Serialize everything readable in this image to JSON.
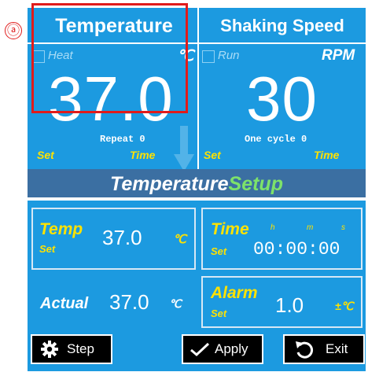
{
  "annotation": {
    "marker": "ⓐ"
  },
  "temperature": {
    "title": "Temperature",
    "heat_label": "Heat",
    "unit": "℃",
    "value": "37.0",
    "repeat": "Repeat 0",
    "set_label": "Set",
    "time_label": "Time"
  },
  "shaking": {
    "title": "Shaking Speed",
    "run_label": "Run",
    "unit": "RPM",
    "value": "30",
    "cycle": "One cycle 0",
    "set_label": "Set",
    "time_label": "Time"
  },
  "setup": {
    "title_main": "Temperature",
    "title_accent": "Setup",
    "temp_label": "Temp",
    "temp_set_label": "Set",
    "temp_value": "37.0",
    "temp_unit": "℃",
    "time_label": "Time",
    "time_set_label": "Set",
    "time_h": "h",
    "time_m": "m",
    "time_s": "s",
    "time_value": "00:00:00",
    "actual_label": "Actual",
    "actual_value": "37.0",
    "actual_unit": "℃",
    "alarm_label": "Alarm",
    "alarm_set_label": "Set",
    "alarm_value": "1.0",
    "alarm_unit": "±℃"
  },
  "buttons": {
    "step": "Step",
    "apply": "Apply",
    "exit": "Exit"
  },
  "colors": {
    "screen": "#1c9ae0",
    "title_bar": "#3b6fa2",
    "yellow": "#ffe200",
    "green": "#7de26a",
    "annotation": "#e01b1b"
  }
}
